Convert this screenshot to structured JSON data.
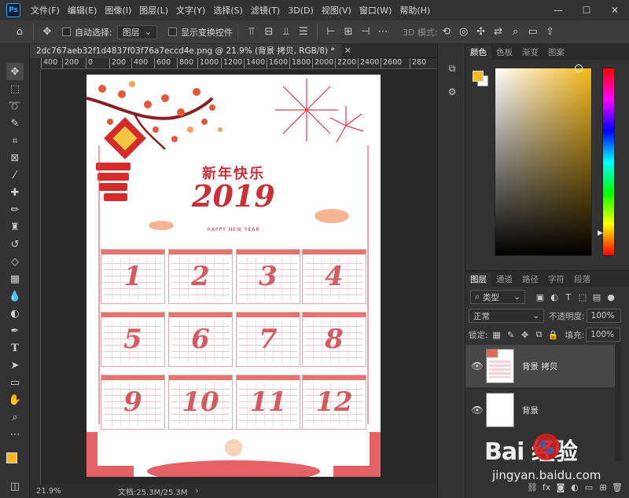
{
  "app": {
    "logo": "Ps"
  },
  "menu": [
    "文件(F)",
    "编辑(E)",
    "图像(I)",
    "图层(L)",
    "文字(Y)",
    "选择(S)",
    "滤镜(T)",
    "3D(D)",
    "视图(V)",
    "窗口(W)",
    "帮助(H)"
  ],
  "window_controls": [
    "—",
    "☐",
    "✕"
  ],
  "options_bar": {
    "auto_select_label": "自动选择:",
    "auto_select_value": "图层",
    "show_transform_label": "显示变换控件",
    "mode_3d_label": "3D 模式:"
  },
  "document": {
    "tab_title": "2dc767aeb32f1d4837f03f76a7eccd4e.png @ 21.9% (背景 拷贝, RGB/8) *",
    "ruler_ticks": [
      "400",
      "200",
      "0",
      "200",
      "400",
      "600",
      "800",
      "1000",
      "1200",
      "1400",
      "1600",
      "1800",
      "2000",
      "2200",
      "2400",
      "2600",
      "280"
    ],
    "zoom": "21.9%",
    "doc_size": "文档:25.3M/25.3M"
  },
  "artwork": {
    "greeting": "新年快乐",
    "year": "2019",
    "subtitle": "HAPPY NEW YEAR",
    "months": [
      "1",
      "2",
      "3",
      "4",
      "5",
      "6",
      "7",
      "8",
      "9",
      "10",
      "11",
      "12"
    ]
  },
  "color_panel": {
    "tabs": [
      "颜色",
      "色板",
      "渐变",
      "图案"
    ],
    "foreground_color": "#f7b626",
    "background_color": "#ffffff"
  },
  "layers_panel": {
    "tabs": [
      "图层",
      "通道",
      "路径",
      "字符",
      "段落"
    ],
    "filter_kind": "类型",
    "blend_mode": "正常",
    "opacity_label": "不透明度:",
    "opacity_value": "100%",
    "lock_label": "锁定:",
    "fill_label": "填充:",
    "fill_value": "100%",
    "layers": [
      {
        "name": "背景 拷贝",
        "visible": true,
        "selected": true
      },
      {
        "name": "背景",
        "visible": true,
        "selected": false
      }
    ]
  },
  "watermark": {
    "logo": "Bai  经验",
    "url": "jingyan.baidu.com"
  }
}
